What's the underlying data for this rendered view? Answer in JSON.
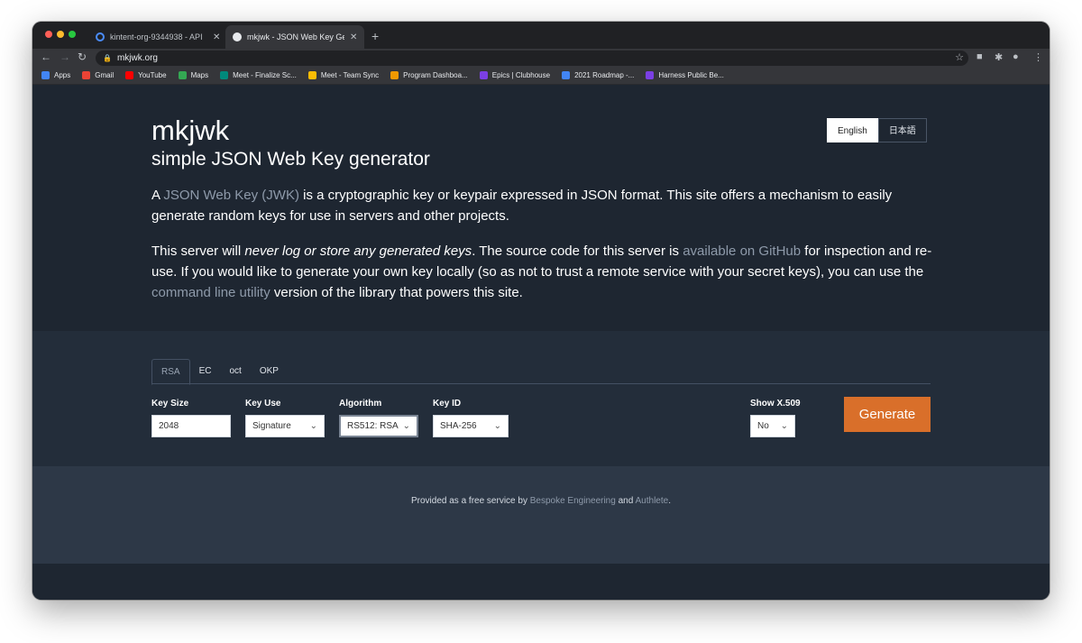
{
  "browser": {
    "tabs": [
      {
        "title": "kintent-org-9344938 - API",
        "favicon_color": "#4a8cff"
      },
      {
        "title": "mkjwk - JSON Web Key Gener",
        "favicon_color": "#ffffff"
      }
    ],
    "new_tab": "+",
    "address": "mkjwk.org",
    "bookmarks": [
      {
        "label": "Apps",
        "color": "#4285f4"
      },
      {
        "label": "Gmail",
        "color": "#ea4335"
      },
      {
        "label": "YouTube",
        "color": "#ff0000"
      },
      {
        "label": "Maps",
        "color": "#34a853"
      },
      {
        "label": "Meet - Finalize Sc...",
        "color": "#00897b"
      },
      {
        "label": "Meet - Team Sync",
        "color": "#fbbc04"
      },
      {
        "label": "Program Dashboa...",
        "color": "#f29900"
      },
      {
        "label": "Epics | Clubhouse",
        "color": "#7b3fe4"
      },
      {
        "label": "2021 Roadmap -...",
        "color": "#4285f4"
      },
      {
        "label": "Harness Public Be...",
        "color": "#7b3fe4"
      }
    ]
  },
  "hero": {
    "title": "mkjwk",
    "subtitle": "simple JSON Web Key generator",
    "languages": [
      "English",
      "日本語"
    ],
    "p1_pre": "A ",
    "p1_link": "JSON Web Key (JWK)",
    "p1_post": " is a cryptographic key or keypair expressed in JSON format. This site offers a mechanism to easily generate random keys for use in servers and other projects.",
    "p2_pre": "This server will ",
    "p2_em": "never log or store any generated keys",
    "p2_mid": ". The source code for this server is ",
    "p2_link1": "available on GitHub",
    "p2_mid2": " for inspection and re-use. If you would like to generate your own key locally (so as not to trust a remote service with your secret keys), you can use the ",
    "p2_link2": "command line utility",
    "p2_post": " version of the library that powers this site."
  },
  "form": {
    "key_types": [
      "RSA",
      "EC",
      "oct",
      "OKP"
    ],
    "active_key_type": "RSA",
    "fields": {
      "key_size": {
        "label": "Key Size",
        "value": "2048"
      },
      "key_use": {
        "label": "Key Use",
        "value": "Signature"
      },
      "algorithm": {
        "label": "Algorithm",
        "value": "RS512: RSA"
      },
      "key_id": {
        "label": "Key ID",
        "value": "SHA-256"
      },
      "show_x509": {
        "label": "Show X.509",
        "value": "No"
      }
    },
    "generate_label": "Generate"
  },
  "footer": {
    "pre": "Provided as a free service by ",
    "link1": "Bespoke Engineering",
    "mid": " and ",
    "link2": "Authlete",
    "post": "."
  },
  "colors": {
    "accent": "#d96f2a",
    "link": "#8e9aaa",
    "background": "#1e2631"
  }
}
